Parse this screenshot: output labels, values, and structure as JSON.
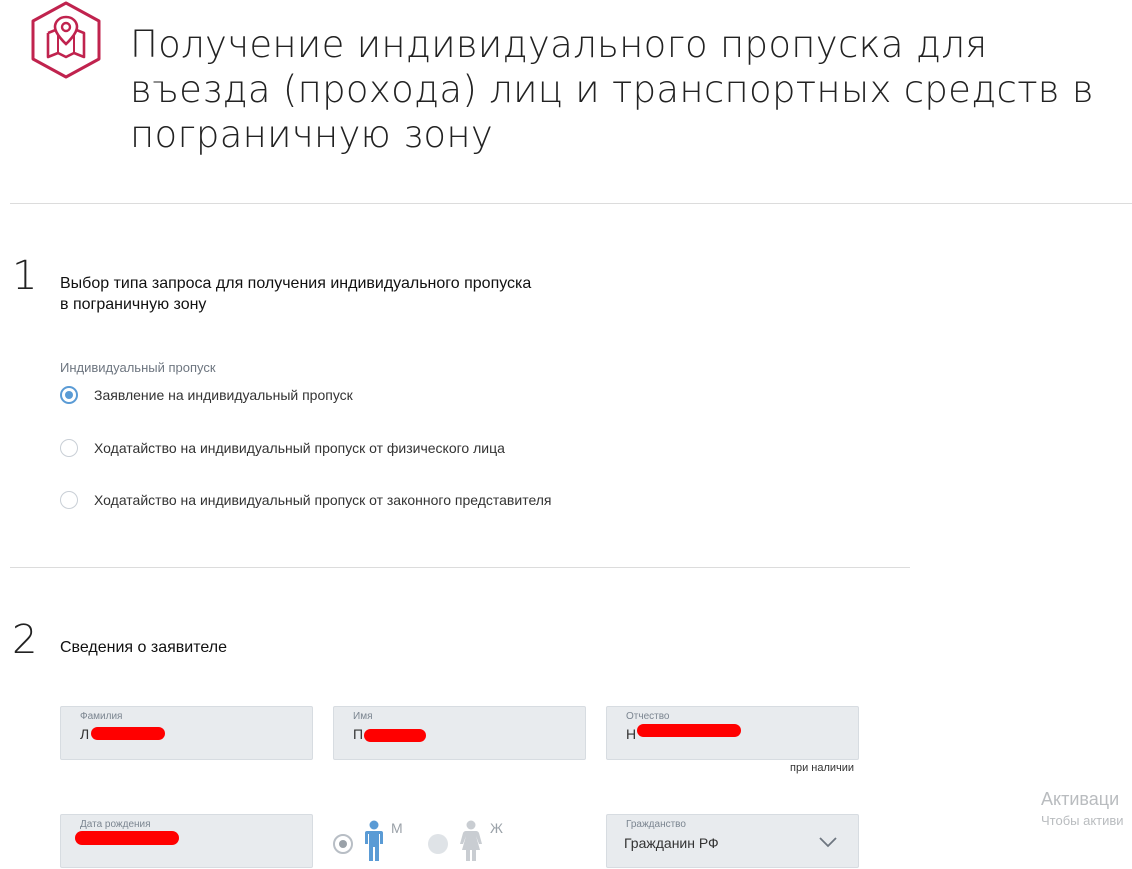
{
  "header": {
    "title": "Получение индивидуального пропуска для въезда (прохода) лиц и транспортных средств в пограничную зону",
    "logo_icon": "map-pin-icon",
    "logo_color": "#c0234e"
  },
  "step1": {
    "number": "1",
    "title": "Выбор типа запроса для получения индивидуального пропуска в пограничную зону",
    "group_label": "Индивидуальный пропуск",
    "options": [
      {
        "label": "Заявление на индивидуальный пропуск",
        "checked": true
      },
      {
        "label": "Ходатайство на индивидуальный пропуск от физического лица",
        "checked": false
      },
      {
        "label": "Ходатайство на индивидуальный пропуск от законного представителя",
        "checked": false
      }
    ]
  },
  "step2": {
    "number": "2",
    "title": "Сведения о заявителе",
    "fields": {
      "surname": {
        "label": "Фамилия",
        "value": "Л"
      },
      "name": {
        "label": "Имя",
        "value": "П"
      },
      "patronymic": {
        "label": "Отчество",
        "value": "Н",
        "hint": "при наличии"
      },
      "birthdate": {
        "label": "Дата рождения",
        "value": ""
      },
      "citizenship": {
        "label": "Гражданство",
        "value": "Гражданин РФ"
      }
    },
    "gender": {
      "male_label": "М",
      "female_label": "Ж",
      "selected": "М",
      "male_color": "#5a9bd5",
      "female_color": "#c9cdd2"
    }
  },
  "watermark": {
    "line1": "Активаци",
    "line2": "Чтобы активи"
  },
  "colors": {
    "accent": "#5a9bd5",
    "redaction": "#ff0000",
    "field_bg": "#e8ebee"
  }
}
